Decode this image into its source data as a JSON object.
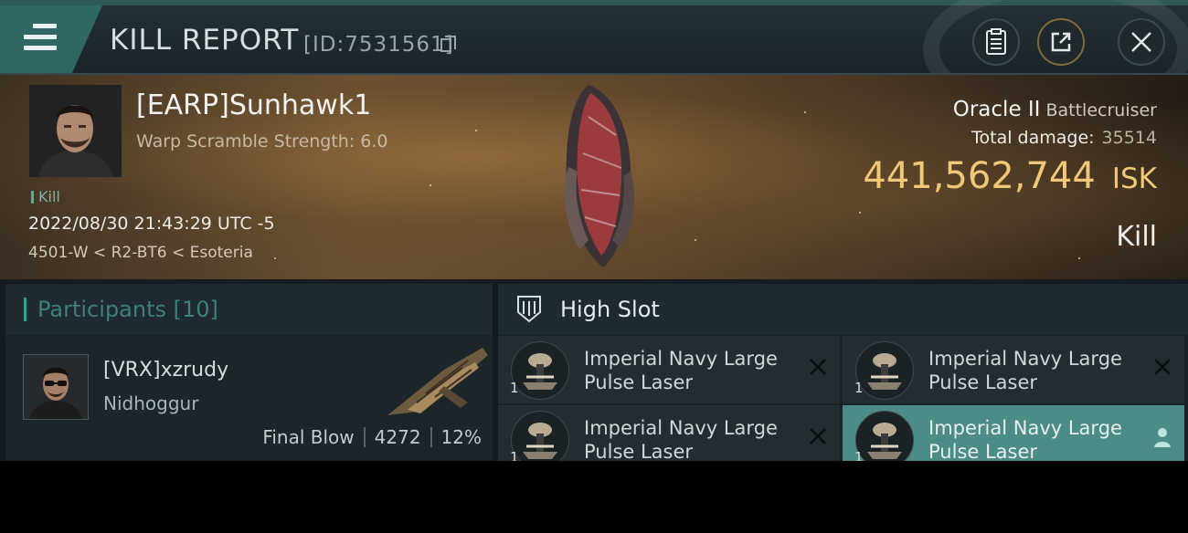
{
  "header": {
    "title": "KILL REPORT",
    "report_id": "[ID:7531561]"
  },
  "victim": {
    "name": "[EARP]Sunhawk1",
    "warp_scramble": "Warp Scramble Strength: 6.0",
    "kill_tag": "Kill",
    "timestamp": "2022/08/30 21:43:29 UTC -5",
    "location": "4501-W < R2-BT6 < Esoteria",
    "ship_name": "Oracle II",
    "ship_class": "Battlecruiser",
    "total_damage_label": "Total damage:",
    "total_damage": "35514",
    "isk_value": "441,562,744",
    "isk_unit": "ISK",
    "result": "Kill"
  },
  "participants": {
    "title": "Participants [10]",
    "items": [
      {
        "name": "[VRX]xzrudy",
        "ship": "Nidhoggur",
        "blow": "Final Blow",
        "damage": "4272",
        "percent": "12%"
      }
    ]
  },
  "high_slot": {
    "title": "High Slot",
    "slots": [
      {
        "name": "Imperial Navy Large Pulse Laser",
        "qty": "1",
        "action_icon": "close-icon"
      },
      {
        "name": "Imperial Navy Large Pulse Laser",
        "qty": "1",
        "action_icon": "close-icon"
      },
      {
        "name": "Imperial Navy Large Pulse Laser",
        "qty": "1",
        "action_icon": "close-icon"
      },
      {
        "name": "Imperial Navy Large Pulse Laser",
        "qty": "1",
        "action_icon": "person-icon"
      }
    ]
  },
  "colors": {
    "accent_teal": "#2f6863",
    "isk_gold": "#f0c877",
    "active_slot": "#4c8c86"
  }
}
